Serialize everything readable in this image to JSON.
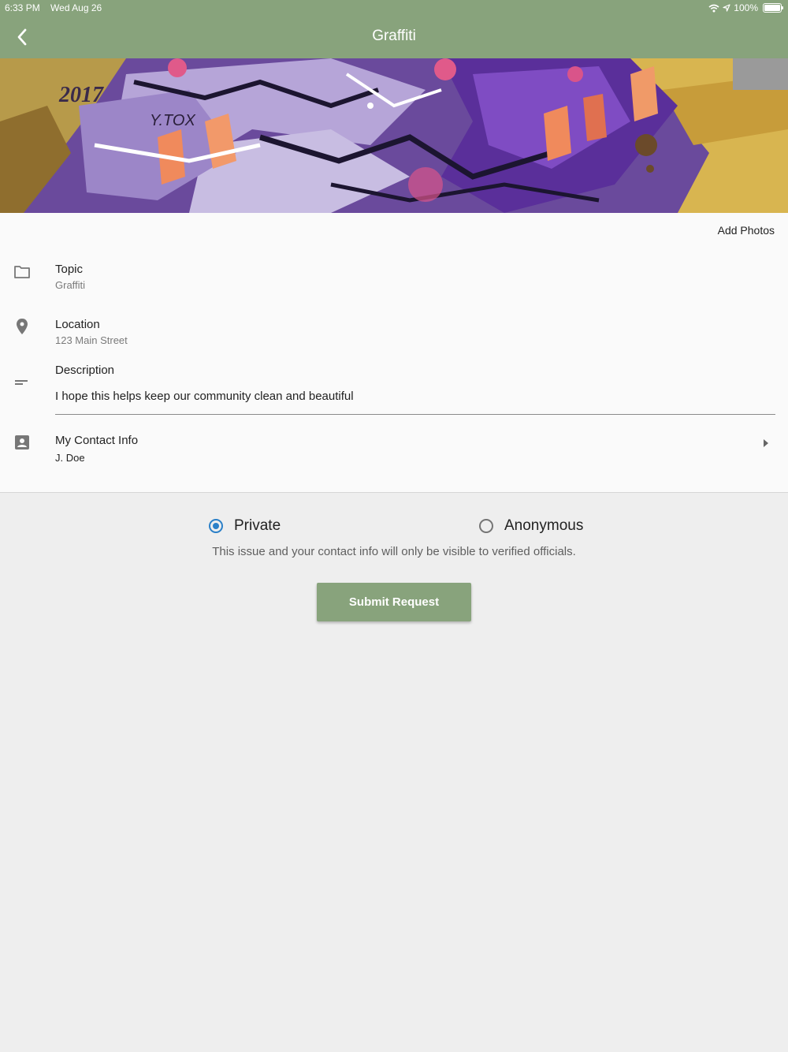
{
  "status_bar": {
    "time": "6:33 PM",
    "date": "Wed Aug 26",
    "battery": "100%",
    "icons": [
      "wifi-icon",
      "location-arrow-icon",
      "battery-icon"
    ]
  },
  "nav": {
    "title": "Graffiti",
    "back_icon": "chevron-left-icon"
  },
  "hero": {
    "image": "graffiti-mural-photo",
    "text": [
      "2017",
      "Y.TOX"
    ]
  },
  "form": {
    "add_photos_label": "Add Photos",
    "topic": {
      "label": "Topic",
      "value": "Graffiti",
      "icon": "folder-icon"
    },
    "location": {
      "label": "Location",
      "value": "123 Main Street",
      "icon": "map-pin-icon"
    },
    "description": {
      "label": "Description",
      "value": "I hope this helps keep our community clean and beautiful",
      "icon": "short-text-icon"
    },
    "contact": {
      "label": "My Contact Info",
      "value": "J. Doe",
      "icon": "contact-card-icon",
      "chevron_icon": "caret-right-icon"
    }
  },
  "privacy": {
    "options": [
      {
        "label": "Private",
        "selected": true
      },
      {
        "label": "Anonymous",
        "selected": false
      }
    ],
    "note": "This issue and your contact info will only be visible to verified officials."
  },
  "submit": {
    "label": "Submit Request"
  },
  "colors": {
    "accent": "#88a37c",
    "radio": "#2b80c8",
    "background": "#eeeeee",
    "card": "#fafafa"
  }
}
